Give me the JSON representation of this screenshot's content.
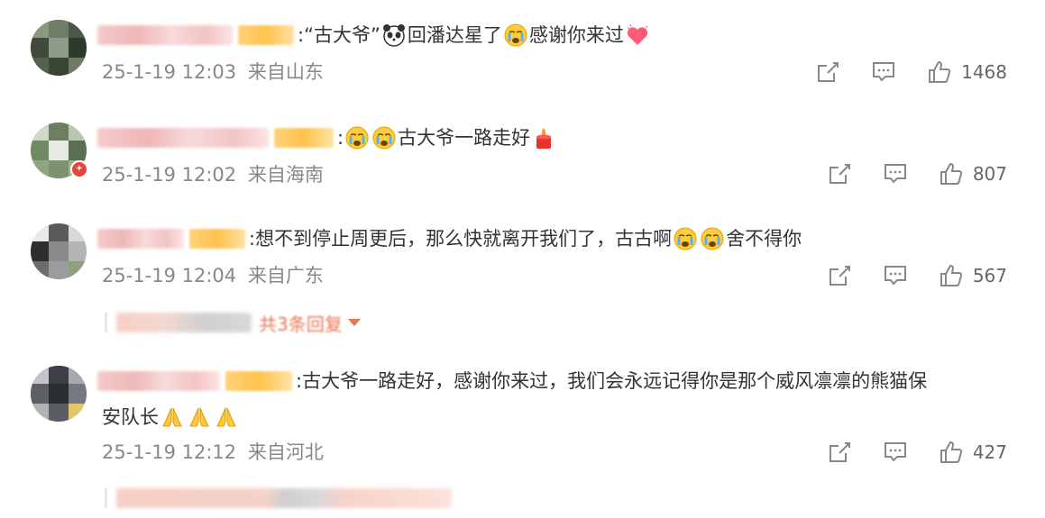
{
  "comments": [
    {
      "text": ":“古大爷”",
      "text_after_panda": "回潘达星了",
      "text_after_cry": "感谢你来过",
      "timestamp": "25-1-19 12:03",
      "location": "来自山东",
      "likes": "1468"
    },
    {
      "text": ":",
      "text_after_cry": "古大爷一路走好",
      "timestamp": "25-1-19 12:02",
      "location": "来自海南",
      "likes": "807"
    },
    {
      "text": ":想不到停止周更后，那么快就离开我们了，古古啊",
      "text_after_cry": "舍不得你",
      "timestamp": "25-1-19 12:04",
      "location": "来自广东",
      "likes": "567",
      "reply_more": "共3条回复"
    },
    {
      "text": ":古大爷一路走好，感谢你来过，我们会永远记得你是那个威风凛凛的熊猫保",
      "text_line2": "安队长",
      "timestamp": "25-1-19 12:12",
      "location": "来自河北",
      "likes": "427"
    }
  ],
  "icons": [
    "share-icon",
    "comment-icon",
    "like-icon",
    "panda-emoji",
    "crying-emoji",
    "heart-emoji",
    "candle-emoji",
    "pray-emoji"
  ],
  "colors": {
    "accent": "#eb7350",
    "meta": "#888888",
    "text": "#333333"
  }
}
